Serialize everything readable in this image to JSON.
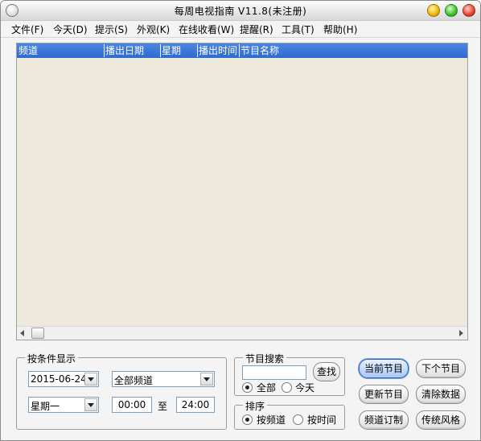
{
  "window": {
    "title": "每周电视指南 V11.8(未注册)"
  },
  "menu": [
    {
      "label": "文件(F)"
    },
    {
      "label": "今天(D)"
    },
    {
      "label": "提示(S)"
    },
    {
      "label": "外观(K)"
    },
    {
      "label": "在线收看(W)"
    },
    {
      "label": "提醒(R)"
    },
    {
      "label": "工具(T)"
    },
    {
      "label": "帮助(H)"
    }
  ],
  "list": {
    "columns": [
      {
        "label": "频道"
      },
      {
        "label": "播出日期"
      },
      {
        "label": "星期"
      },
      {
        "label": "播出时间"
      },
      {
        "label": "节目名称"
      }
    ],
    "header_color": "#316AC5",
    "body_color": "#EDEADB"
  },
  "filter": {
    "legend": "按条件显示",
    "date": "2015-06-24",
    "channel": "全部频道",
    "weekday": "星期一",
    "time_from": "00:00",
    "to_label": "至",
    "time_to": "24:00"
  },
  "search": {
    "legend": "节目搜索",
    "placeholder": "",
    "find_label": "查找",
    "scope_all": "全部",
    "scope_today": "今天",
    "selected": "全部"
  },
  "sort": {
    "legend": "排序",
    "by_channel": "按频道",
    "by_time": "按时间",
    "selected": "按频道"
  },
  "buttons": {
    "current_program": "当前节目",
    "next_program": "下个节目",
    "update_program": "更新节目",
    "clear_data": "清除数据",
    "channel_subscribe": "频道订制",
    "classic_style": "传统风格"
  }
}
